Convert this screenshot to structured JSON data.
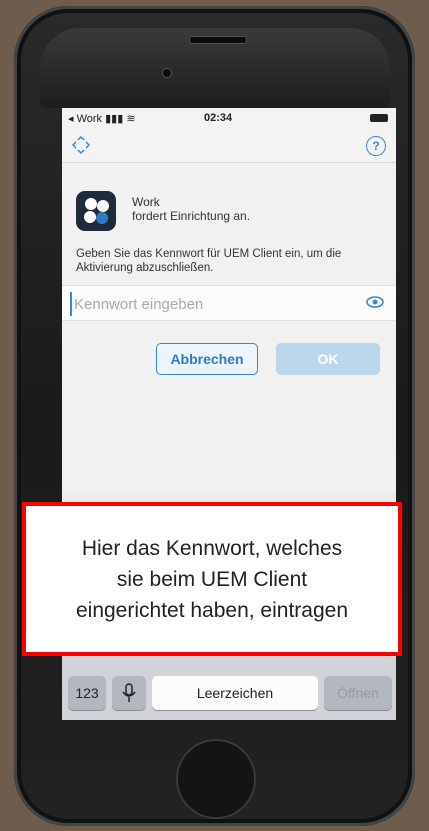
{
  "status_bar": {
    "back_label": "◂ Work",
    "signal": "▮▮▮",
    "wifi": "≋",
    "time": "02:34"
  },
  "navbar": {
    "logo_icon": "diamond-arrows-icon",
    "help_label": "?"
  },
  "dialog": {
    "app_name": "Work",
    "request_text": "fordert Einrichtung an.",
    "instruction": "Geben Sie das Kennwort für UEM Client ein, um die Aktivierung abzuschließen.",
    "password_placeholder": "Kennwort eingeben",
    "password_value": "",
    "cancel_label": "Abbrechen",
    "ok_label": "OK"
  },
  "keyboard": {
    "numbers_key": "123",
    "mic_icon": "microphone-icon",
    "space_label": "Leerzeichen",
    "return_label": "Öffnen"
  },
  "callout": {
    "line1": "Hier das Kennwort, welches",
    "line2": "sie beim UEM Client",
    "line3": "eingerichtet haben, eintragen"
  },
  "colors": {
    "accent": "#3a86d8",
    "callout_border": "#ff0000",
    "ok_disabled": "#bcd6ec"
  }
}
